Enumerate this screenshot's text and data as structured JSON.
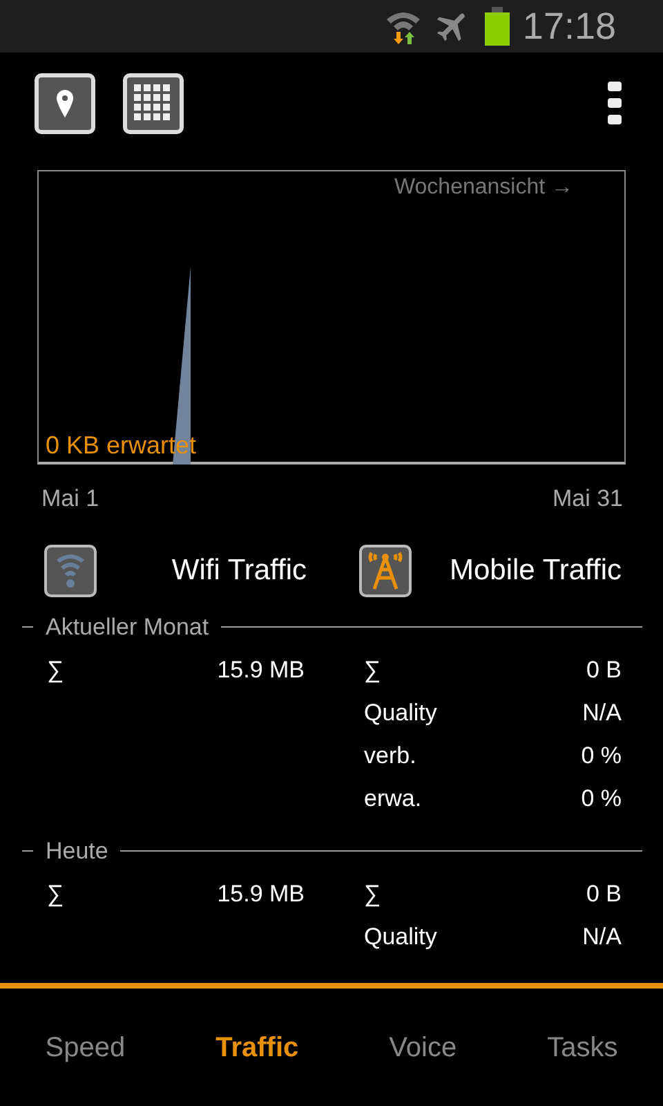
{
  "status_bar": {
    "time": "17:18"
  },
  "chart": {
    "link": "Wochenansicht →",
    "expected": "0 KB erwartet",
    "x_start": "Mai 1",
    "x_end": "Mai 31"
  },
  "headers": [
    {
      "kind": "wifi",
      "label": "Wifi Traffic"
    },
    {
      "kind": "mobile",
      "label": "Mobile Traffic"
    }
  ],
  "sections": [
    {
      "title": "Aktueller Monat",
      "wifi": [
        {
          "label": "∑",
          "value": "15.9 MB"
        }
      ],
      "mobile": [
        {
          "label": "∑",
          "value": "0 B"
        },
        {
          "label": "Quality",
          "value": "N/A"
        },
        {
          "label": "verb.",
          "value": "0 %"
        },
        {
          "label": "erwa.",
          "value": "0 %"
        }
      ]
    },
    {
      "title": "Heute",
      "wifi": [
        {
          "label": "∑",
          "value": "15.9 MB"
        }
      ],
      "mobile": [
        {
          "label": "∑",
          "value": "0 B"
        },
        {
          "label": "Quality",
          "value": "N/A"
        }
      ]
    }
  ],
  "tabs": [
    {
      "label": "Speed",
      "selected": false
    },
    {
      "label": "Traffic",
      "selected": true
    },
    {
      "label": "Voice",
      "selected": false
    },
    {
      "label": "Tasks",
      "selected": false
    }
  ]
}
